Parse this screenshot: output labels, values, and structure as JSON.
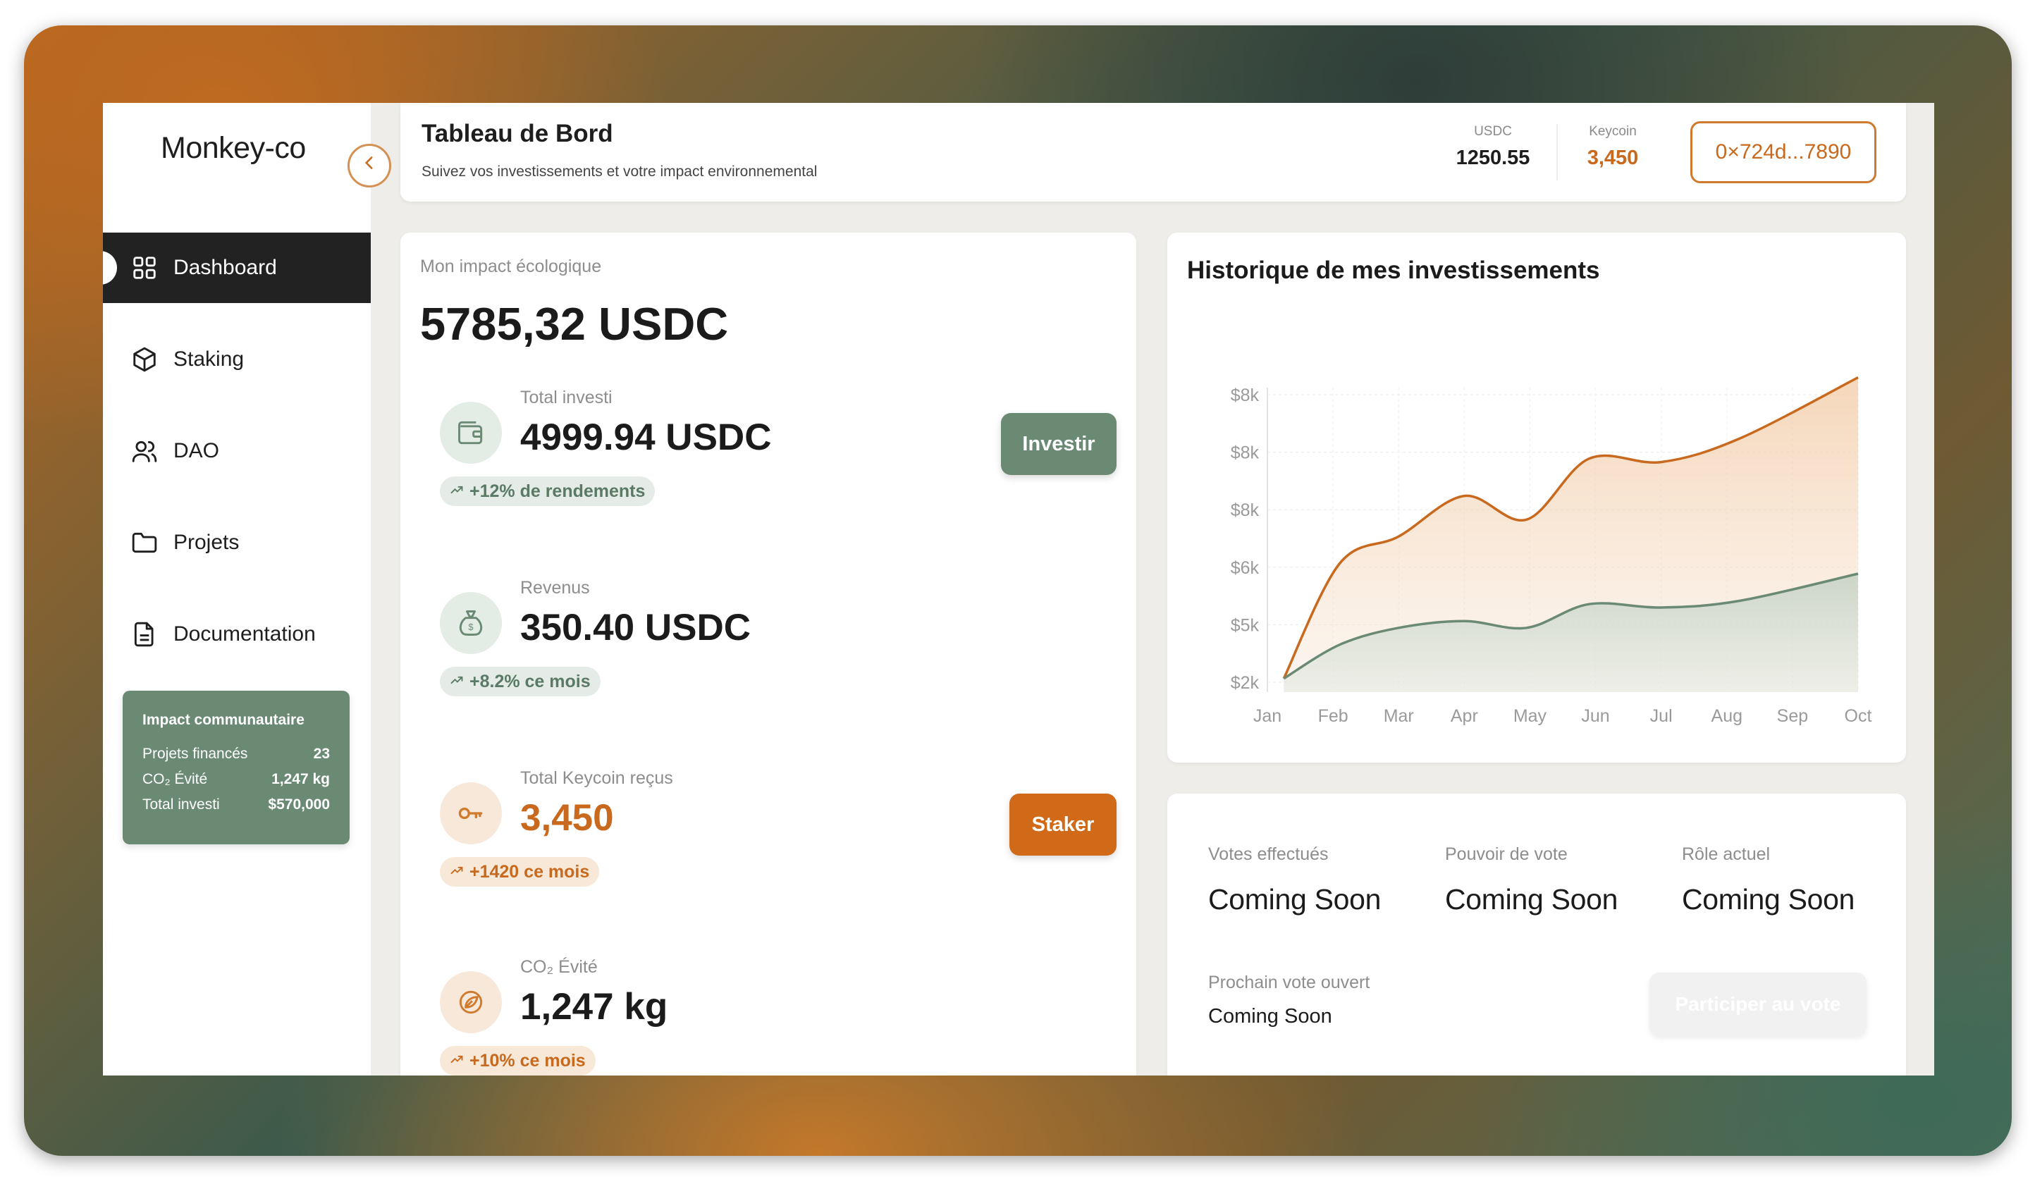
{
  "app": {
    "logo": "Monkey-co"
  },
  "sidebar": {
    "items": [
      {
        "label": "Dashboard",
        "icon": "grid-icon",
        "active": true
      },
      {
        "label": "Staking",
        "icon": "cube-icon"
      },
      {
        "label": "DAO",
        "icon": "users-icon"
      },
      {
        "label": "Projets",
        "icon": "folder-icon"
      },
      {
        "label": "Documentation",
        "icon": "document-icon"
      }
    ],
    "impact": {
      "title": "Impact communautaire",
      "rows": [
        {
          "label": "Projets financés",
          "value": "23"
        },
        {
          "label": "CO₂ Évité",
          "value": "1,247 kg"
        },
        {
          "label": "Total investi",
          "value": "$570,000"
        }
      ]
    }
  },
  "header": {
    "title": "Tableau de Bord",
    "subtitle": "Suivez vos investissements et votre impact environnemental",
    "usdc_label": "USDC",
    "usdc_value": "1250.55",
    "keycoin_label": "Keycoin",
    "keycoin_value": "3,450",
    "wallet": "0×724d...7890"
  },
  "eco": {
    "label": "Mon impact écologique",
    "total": "5785,32 USDC",
    "stats": [
      {
        "label": "Total investi",
        "value": "4999.94 USDC",
        "pill": "+12% de rendements",
        "button": "Investir"
      },
      {
        "label": "Revenus",
        "value": "350.40 USDC",
        "pill": "+8.2% ce mois"
      },
      {
        "label": "Total Keycoin reçus",
        "value": "3,450",
        "pill": "+1420 ce mois",
        "button": "Staker"
      },
      {
        "label": "CO₂ Évité",
        "value": "1,247 kg",
        "pill": "+10% ce mois"
      }
    ]
  },
  "history": {
    "title": "Historique de mes investissements"
  },
  "chart_data": {
    "type": "area",
    "title": "Historique de mes investissements",
    "categories": [
      "Jan",
      "Feb",
      "Mar",
      "Apr",
      "May",
      "Jun",
      "Jul",
      "Aug",
      "Sep",
      "Oct"
    ],
    "y_tick_labels": [
      "$2k",
      "$5k",
      "$6k",
      "$8k",
      "$8k",
      "$8k"
    ],
    "ylim": [
      0,
      9000
    ],
    "grid": true,
    "series": [
      {
        "color": "#c8691e",
        "values": [
          400,
          3800,
          4600,
          5800,
          5100,
          6900,
          6800,
          7500,
          9300
        ]
      },
      {
        "color": "#6b8a74",
        "values": [
          400,
          1400,
          1900,
          2100,
          1900,
          2600,
          2500,
          2700,
          3500
        ]
      }
    ],
    "x_points": [
      0.25,
      1.1,
      2.0,
      3.0,
      3.95,
      4.9,
      6.0,
      7.2,
      9.0
    ]
  },
  "dao": {
    "cols": [
      {
        "label": "Votes effectués",
        "value": "Coming Soon"
      },
      {
        "label": "Pouvoir de vote",
        "value": "Coming Soon"
      },
      {
        "label": "Rôle actuel",
        "value": "Coming Soon"
      }
    ],
    "next_label": "Prochain vote ouvert",
    "next_value": "Coming Soon",
    "vote_button": "Participer au vote"
  },
  "colors": {
    "accent_orange": "#c8691e",
    "accent_green": "#6b8a74",
    "dark": "#222222"
  }
}
